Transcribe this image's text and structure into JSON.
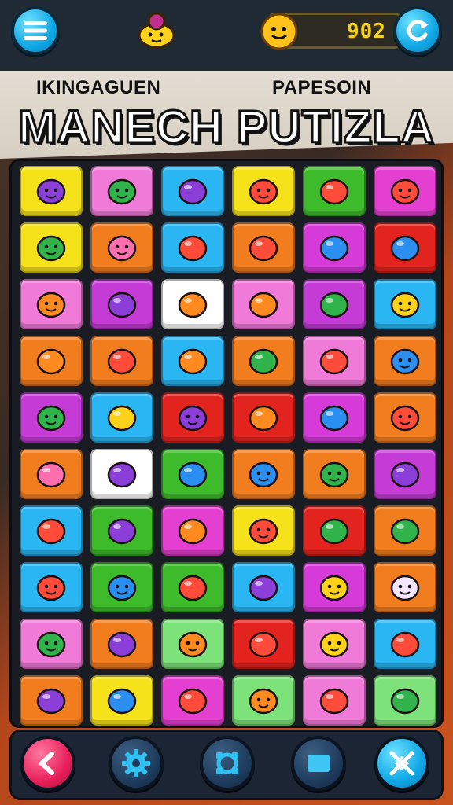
{
  "header": {
    "menu_icon": "hamburger-menu-icon",
    "mascot_icon": "onion-mascot-icon",
    "coin_icon": "smiley-coin-icon",
    "score": "902",
    "refresh_icon": "refresh-icon"
  },
  "titles": {
    "subtitle_left": "IKINGAGUEN",
    "subtitle_right": "PAPESOIN",
    "main": "MANECH PUTIZLA"
  },
  "board": {
    "rows": 9,
    "cols": 6,
    "tiles": [
      [
        {
          "bg": "#f5e21a",
          "icon": "purple-blob-face-icon"
        },
        {
          "bg": "#f07ad8",
          "icon": "green-hat-cat-icon"
        },
        {
          "bg": "#29b6f2",
          "icon": "purple-eggplant-icon"
        },
        {
          "bg": "#f5e21a",
          "icon": "red-ball-face-icon"
        },
        {
          "bg": "#3dbb2a",
          "icon": "red-bean-icon"
        },
        {
          "bg": "#e43fd0",
          "icon": "bandana-cat-icon"
        }
      ],
      [
        {
          "bg": "#f5e21a",
          "icon": "green-hat-cat-icon"
        },
        {
          "bg": "#f27d1f",
          "icon": "pink-fish-face-icon"
        },
        {
          "bg": "#29b6f2",
          "icon": "treasure-box-icon"
        },
        {
          "bg": "#f27d1f",
          "icon": "red-beetle-icon"
        },
        {
          "bg": "#d63ad8",
          "icon": "blue-capsule-icon"
        },
        {
          "bg": "#e3231e",
          "icon": "blue-ring-icon"
        }
      ],
      [
        {
          "bg": "#f07ad8",
          "icon": "orange-smile-face-icon"
        },
        {
          "bg": "#c43bd6",
          "icon": "purple-berry-icon"
        },
        {
          "bg": "#ffffff",
          "icon": "orange-drumstick-icon"
        },
        {
          "bg": "#f07ad8",
          "icon": "orange-cube-icon"
        },
        {
          "bg": "#c43bd6",
          "icon": "green-leaf-icon"
        },
        {
          "bg": "#29b6f2",
          "icon": "yellow-chick-face-icon"
        }
      ],
      [
        {
          "bg": "#f27d1f",
          "icon": "carrot-icon"
        },
        {
          "bg": "#f27d1f",
          "icon": "red-flower-icon"
        },
        {
          "bg": "#29b6f2",
          "icon": "orange-bottle-icon"
        },
        {
          "bg": "#f27d1f",
          "icon": "green-apple-icon"
        },
        {
          "bg": "#f07ad8",
          "icon": "pizza-slice-icon"
        },
        {
          "bg": "#f27d1f",
          "icon": "blue-robot-face-icon"
        }
      ],
      [
        {
          "bg": "#c43bd6",
          "icon": "teal-monster-face-icon"
        },
        {
          "bg": "#29b6f2",
          "icon": "yellow-gem-icon"
        },
        {
          "bg": "#e3231e",
          "icon": "purple-blob-face-icon"
        },
        {
          "bg": "#e3231e",
          "icon": "orange-fruit-icon"
        },
        {
          "bg": "#d63ad8",
          "icon": "blue-bug-icon"
        },
        {
          "bg": "#f27d1f",
          "icon": "spiky-sun-face-icon"
        }
      ],
      [
        {
          "bg": "#f27d1f",
          "icon": "pink-donut-icon"
        },
        {
          "bg": "#ffffff",
          "icon": "purple-candy-icon"
        },
        {
          "bg": "#3dbb2a",
          "icon": "blue-bubble-icon"
        },
        {
          "bg": "#f27d1f",
          "icon": "blue-cat-face-icon"
        },
        {
          "bg": "#f27d1f",
          "icon": "green-smile-face-icon"
        },
        {
          "bg": "#c43bd6",
          "icon": "purple-tag-icon"
        }
      ],
      [
        {
          "bg": "#29b6f2",
          "icon": "red-fruit-icon"
        },
        {
          "bg": "#3dbb2a",
          "icon": "purple-card-icon"
        },
        {
          "bg": "#e43fd0",
          "icon": "orange-swirl-icon"
        },
        {
          "bg": "#f5e21a",
          "icon": "red-devil-face-icon"
        },
        {
          "bg": "#e3231e",
          "icon": "green-leaf-icon"
        },
        {
          "bg": "#f27d1f",
          "icon": "green-flame-icon"
        }
      ],
      [
        {
          "bg": "#29b6f2",
          "icon": "red-cat-face-icon"
        },
        {
          "bg": "#3dbb2a",
          "icon": "blue-blob-face-icon"
        },
        {
          "bg": "#3dbb2a",
          "icon": "red-ball-icon"
        },
        {
          "bg": "#29b6f2",
          "icon": "purple-mushroom-icon"
        },
        {
          "bg": "#d63ad8",
          "icon": "yellow-smile-face-icon"
        },
        {
          "bg": "#f27d1f",
          "icon": "white-star-face-icon"
        }
      ],
      [
        {
          "bg": "#f07ad8",
          "icon": "green-monster-face-icon"
        },
        {
          "bg": "#f27d1f",
          "icon": "purple-bird-icon"
        },
        {
          "bg": "#7ee27a",
          "icon": "orange-round-face-icon"
        },
        {
          "bg": "#e3231e",
          "icon": "red-berry-icon"
        },
        {
          "bg": "#f07ad8",
          "icon": "yellow-round-face-icon"
        },
        {
          "bg": "#29b6f2",
          "icon": "cookie-box-icon"
        }
      ]
    ],
    "tiles_row9_placeholder": "",
    "last_row": [
      {
        "bg": "#f27d1f",
        "icon": "purple-crayon-icon"
      },
      {
        "bg": "#f5e21a",
        "icon": "blue-ball-icon"
      },
      {
        "bg": "#e43fd0",
        "icon": "ice-cream-cone-icon"
      },
      {
        "bg": "#7ee27a",
        "icon": "orange-fruit-face-icon"
      },
      {
        "bg": "#f07ad8",
        "icon": "strawberry-icon"
      },
      {
        "bg": "#7ee27a",
        "icon": "green-pear-icon"
      }
    ]
  },
  "bottom_bar": {
    "back_icon": "back-arrow-icon",
    "settings_icon": "gear-icon",
    "hint_icon": "swap-ring-icon",
    "stop_icon": "stop-square-icon",
    "shuffle_icon": "shuffle-cross-icon"
  }
}
